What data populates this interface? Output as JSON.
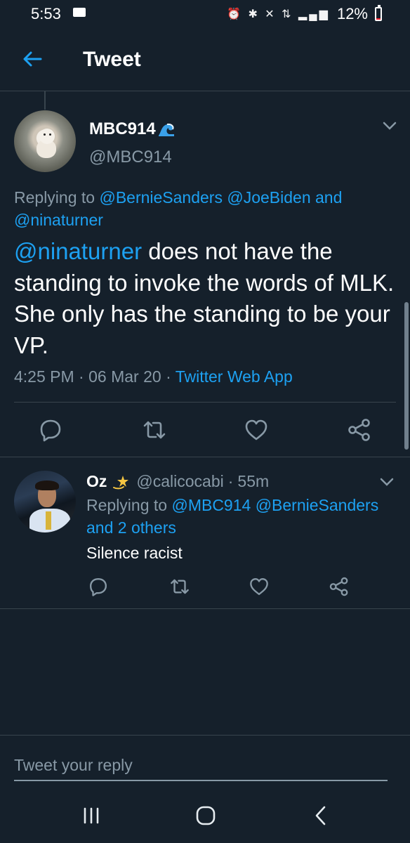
{
  "status_bar": {
    "time": "5:53",
    "battery": "12%",
    "battery_level": 0.12
  },
  "app_bar": {
    "title": "Tweet"
  },
  "main_tweet": {
    "author_name": "MBC914",
    "author_handle": "@MBC914",
    "replying_label": "Replying to",
    "replying_to": [
      "@BernieSanders",
      "@JoeBiden"
    ],
    "replying_and": "and",
    "replying_last": "@ninaturner",
    "mention": "@ninaturner",
    "text": "does not have the standing to invoke the words of MLK.  She only has the standing to be your VP.",
    "time": "4:25 PM",
    "date": "06 Mar 20",
    "separator": "·",
    "source": "Twitter Web App"
  },
  "reply_tweet": {
    "author_name": "Oz",
    "author_handle": "@calicocabi",
    "separator": "·",
    "age": "55m",
    "replying_label": "Replying to",
    "replying_to": [
      "@MBC914",
      "@BernieSanders"
    ],
    "replying_more": "and 2 others",
    "text": "Silence racist"
  },
  "compose": {
    "placeholder": "Tweet your reply"
  },
  "colors": {
    "background": "#15202b",
    "accent": "#1da1f2",
    "secondary_text": "#8899a6",
    "divider": "#38444d"
  },
  "icons": {
    "back": "arrow-left-icon",
    "verified_emoji": "wave-icon",
    "reply_emoji": "dizzy-star-icon",
    "actions": [
      "reply-icon",
      "retweet-icon",
      "like-icon",
      "share-icon"
    ],
    "nav": [
      "recents-icon",
      "home-icon",
      "back-icon"
    ]
  }
}
